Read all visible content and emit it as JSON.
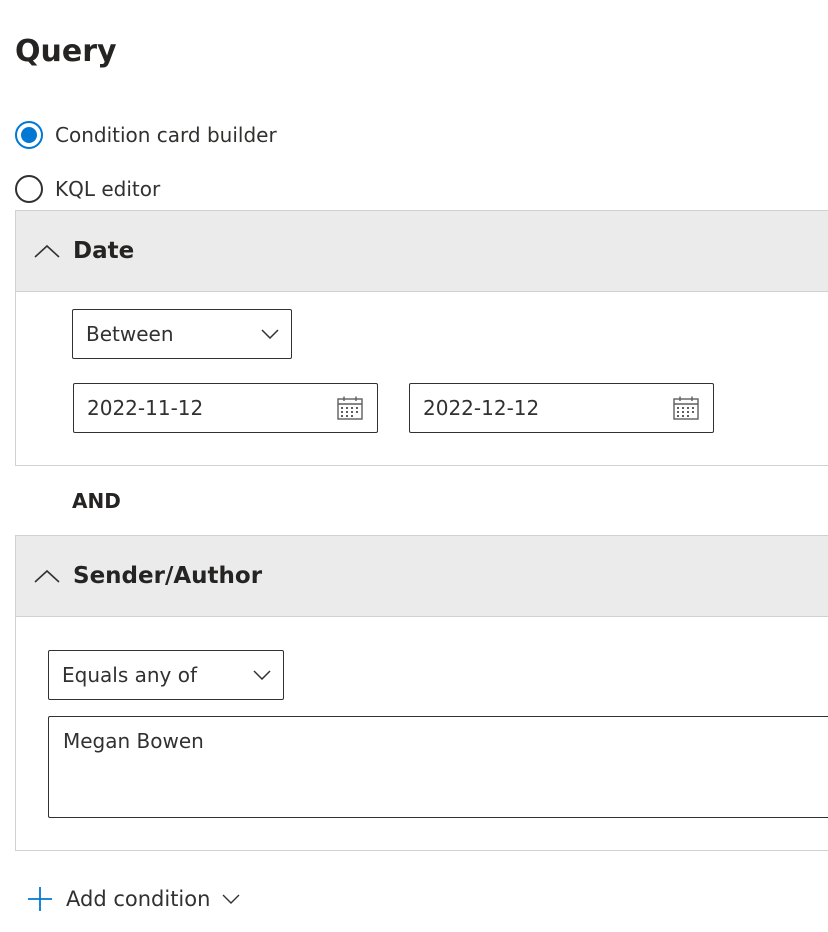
{
  "query": {
    "title": "Query",
    "mode_options": [
      {
        "label": "Condition card builder",
        "selected": true
      },
      {
        "label": "KQL editor",
        "selected": false
      }
    ]
  },
  "date_card": {
    "title": "Date",
    "operator": "Between",
    "start_date": "2022-11-12",
    "end_date": "2022-12-12"
  },
  "join_operator": "AND",
  "sender_card": {
    "title": "Sender/Author",
    "operator": "Equals any of",
    "value": "Megan Bowen"
  },
  "footer": {
    "add_condition_label": "Add condition"
  },
  "colors": {
    "accent": "#0078d4",
    "header_bg": "#ebebeb",
    "border": "#d1d1d1",
    "text": "#323130"
  },
  "icons": [
    "chevron-up-icon",
    "chevron-down-icon",
    "calendar-icon",
    "plus-icon"
  ]
}
